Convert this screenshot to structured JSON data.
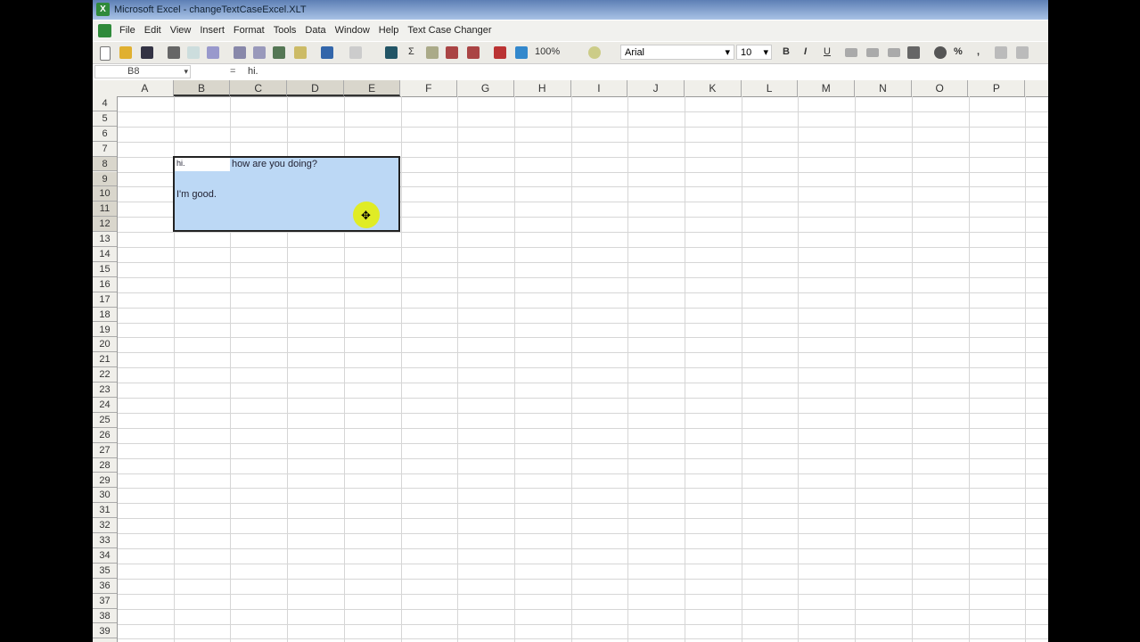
{
  "window_title": "Microsoft Excel - changeTextCaseExcel.XLT",
  "menu": [
    "File",
    "Edit",
    "View",
    "Insert",
    "Format",
    "Tools",
    "Data",
    "Window",
    "Help",
    "Text Case Changer"
  ],
  "toolbar": {
    "zoom": "100%",
    "font": "Arial",
    "size": "10",
    "bold": "B",
    "italic": "I",
    "underline": "U",
    "sum": "Σ",
    "percent": "%",
    "comma": ","
  },
  "formula_bar": {
    "name_box": "B8",
    "fx": "=",
    "value": "hi."
  },
  "columns": [
    "A",
    "B",
    "C",
    "D",
    "E",
    "F",
    "G",
    "H",
    "I",
    "J",
    "K",
    "L",
    "M",
    "N",
    "O",
    "P"
  ],
  "rows": [
    "4",
    "5",
    "6",
    "7",
    "8",
    "9",
    "10",
    "11",
    "12",
    "13",
    "14",
    "15",
    "16",
    "17",
    "18",
    "19",
    "20",
    "21",
    "22",
    "23",
    "24",
    "25",
    "26",
    "27",
    "28",
    "29",
    "30",
    "31",
    "32",
    "33",
    "34",
    "35",
    "36",
    "37",
    "38",
    "39"
  ],
  "cells": {
    "B8": "hi.",
    "C8": "how are you doing?",
    "B10": "I'm good."
  },
  "selection": "B8:E12"
}
